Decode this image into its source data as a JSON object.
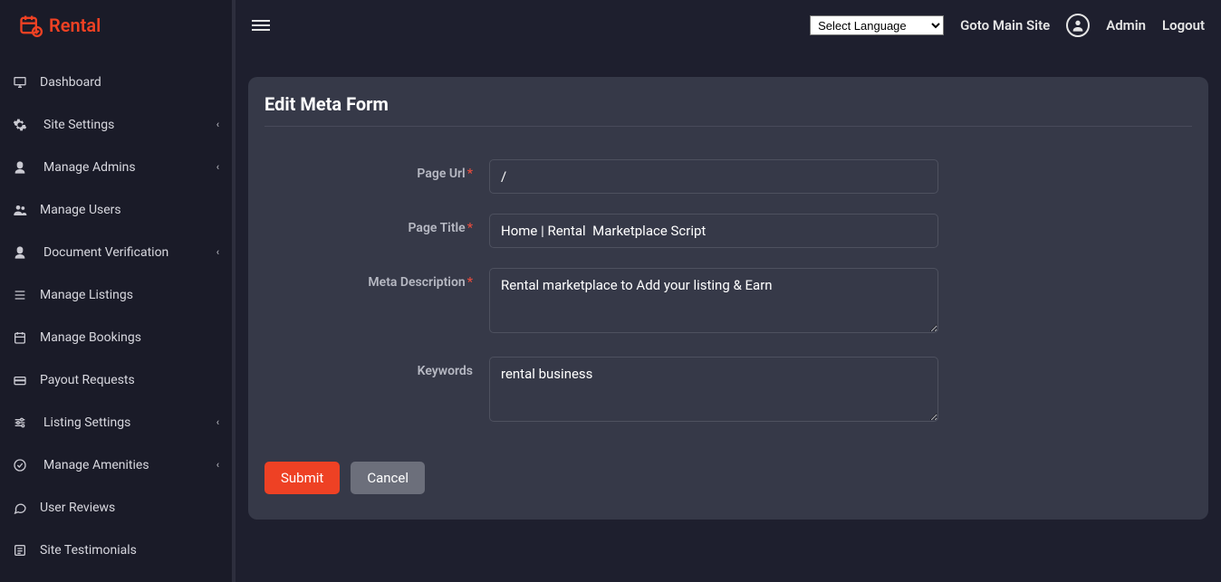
{
  "brand": {
    "name": "Rental"
  },
  "topbar": {
    "language_placeholder": "Select Language",
    "goto_main_site": "Goto Main Site",
    "admin": "Admin",
    "logout": "Logout"
  },
  "sidebar": [
    {
      "icon": "desktop",
      "label": "Dashboard",
      "expandable": false
    },
    {
      "icon": "gear",
      "label": "Site Settings",
      "expandable": true
    },
    {
      "icon": "user-secret",
      "label": "Manage Admins",
      "expandable": true
    },
    {
      "icon": "users",
      "label": "Manage Users",
      "expandable": false
    },
    {
      "icon": "id-card",
      "label": "Document Verification",
      "expandable": true
    },
    {
      "icon": "list",
      "label": "Manage Listings",
      "expandable": false
    },
    {
      "icon": "calendar",
      "label": "Manage Bookings",
      "expandable": false
    },
    {
      "icon": "wallet",
      "label": "Payout Requests",
      "expandable": false
    },
    {
      "icon": "sliders",
      "label": "Listing Settings",
      "expandable": true
    },
    {
      "icon": "check",
      "label": "Manage Amenities",
      "expandable": true
    },
    {
      "icon": "comment",
      "label": "User Reviews",
      "expandable": false
    },
    {
      "icon": "file",
      "label": "Site Testimonials",
      "expandable": false
    }
  ],
  "card": {
    "title": "Edit Meta Form",
    "labels": {
      "page_url": "Page Url",
      "page_title": "Page Title",
      "meta_description": "Meta Description",
      "keywords": "Keywords"
    },
    "values": {
      "page_url": "/",
      "page_title": "Home | Rental  Marketplace Script",
      "meta_description": "Rental marketplace to Add your listing & Earn",
      "keywords": "rental business"
    },
    "buttons": {
      "submit": "Submit",
      "cancel": "Cancel"
    }
  }
}
